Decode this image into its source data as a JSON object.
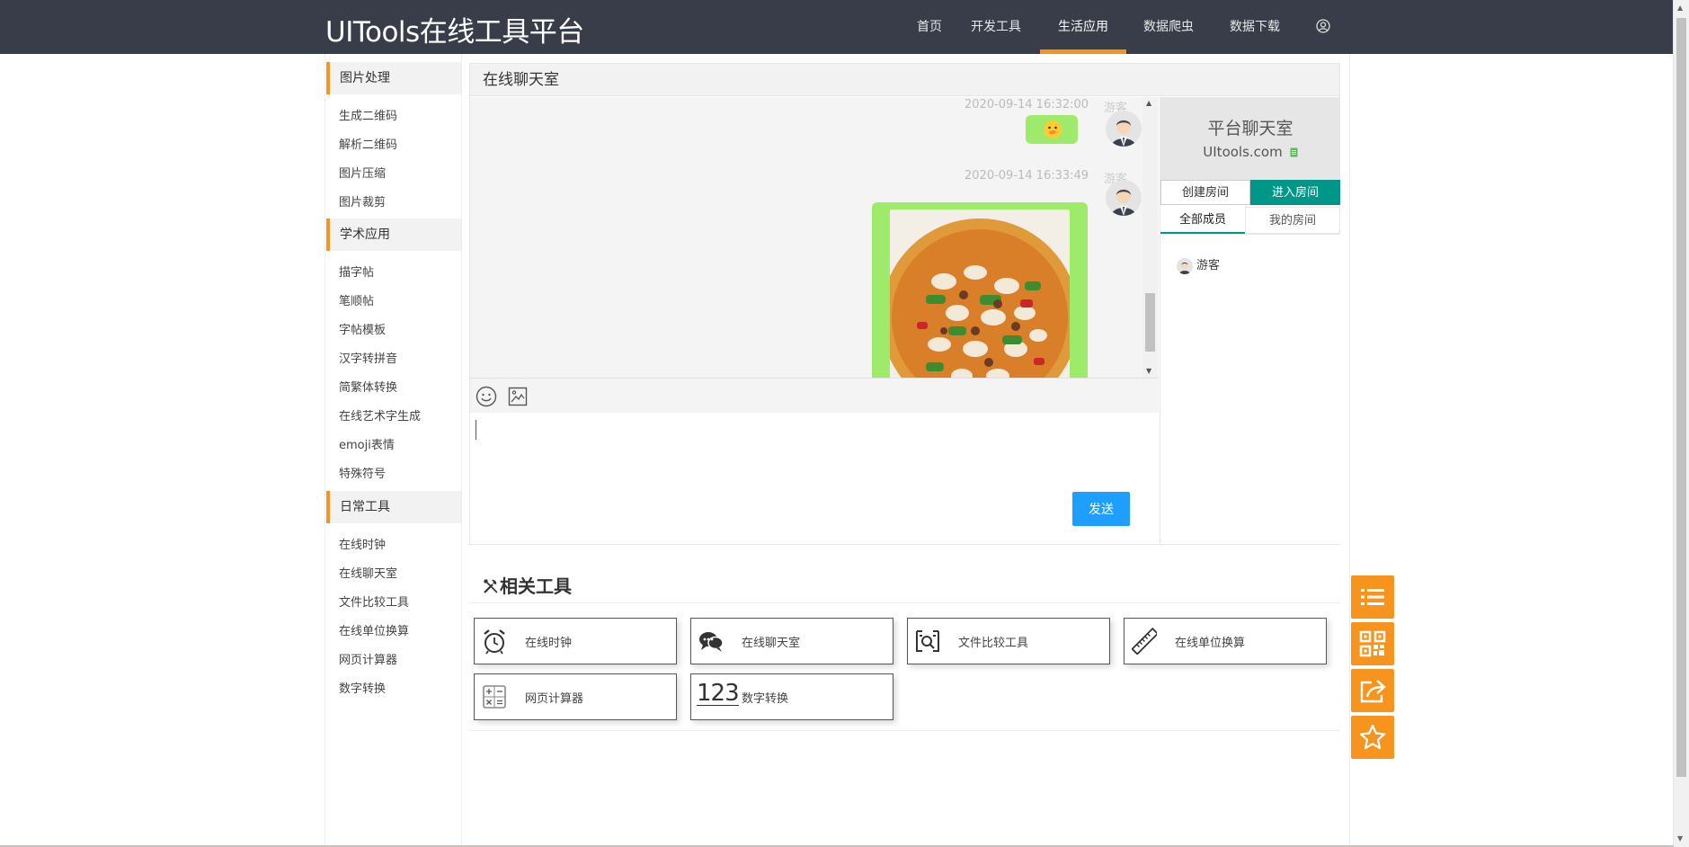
{
  "header": {
    "brand": "UITools在线工具平台",
    "nav": [
      {
        "label": "首页"
      },
      {
        "label": "开发工具"
      },
      {
        "label": "生活应用",
        "active": true
      },
      {
        "label": "数据爬虫"
      },
      {
        "label": "数据下载"
      }
    ],
    "accent_color": "#f7941d",
    "bar_color": "#393d49"
  },
  "sidebar": {
    "sections": [
      {
        "title": "图片处理",
        "items": [
          "生成二维码",
          "解析二维码",
          "图片压缩",
          "图片裁剪"
        ]
      },
      {
        "title": "学术应用",
        "items": [
          "描字帖",
          "笔顺帖",
          "字帖模板",
          "汉字转拼音",
          "简繁体转换",
          "在线艺术字生成",
          "emoji表情",
          "特殊符号"
        ]
      },
      {
        "title": "日常工具",
        "items": [
          "在线时钟",
          "在线聊天室",
          "文件比较工具",
          "在线单位换算",
          "网页计算器",
          "数字转换"
        ]
      }
    ]
  },
  "chat": {
    "title": "在线聊天室",
    "messages": [
      {
        "time": "2020-09-14 16:32:00",
        "user": "游客",
        "content": "emoji"
      },
      {
        "time": "2020-09-14 16:33:49",
        "user": "游客",
        "content": "image"
      }
    ],
    "send_label": "发送",
    "room": {
      "title": "平台聊天室",
      "site": "UItools.com",
      "create_label": "创建房间",
      "enter_label": "进入房间",
      "tab_all": "全部成员",
      "tab_mine": "我的房间",
      "members": [
        "游客"
      ]
    }
  },
  "related": {
    "title": "相关工具",
    "tools": [
      {
        "label": "在线时钟",
        "icon": "alarm-clock-icon"
      },
      {
        "label": "在线聊天室",
        "icon": "chat-bubbles-icon"
      },
      {
        "label": "文件比较工具",
        "icon": "file-compare-icon"
      },
      {
        "label": "在线单位换算",
        "icon": "ruler-icon"
      },
      {
        "label": "网页计算器",
        "icon": "calculator-icon"
      },
      {
        "label": "数字转换",
        "icon": "number-123-icon"
      }
    ],
    "number_icon_text": "123"
  },
  "float_buttons": [
    "list-icon",
    "qrcode-icon",
    "share-icon",
    "star-icon"
  ]
}
